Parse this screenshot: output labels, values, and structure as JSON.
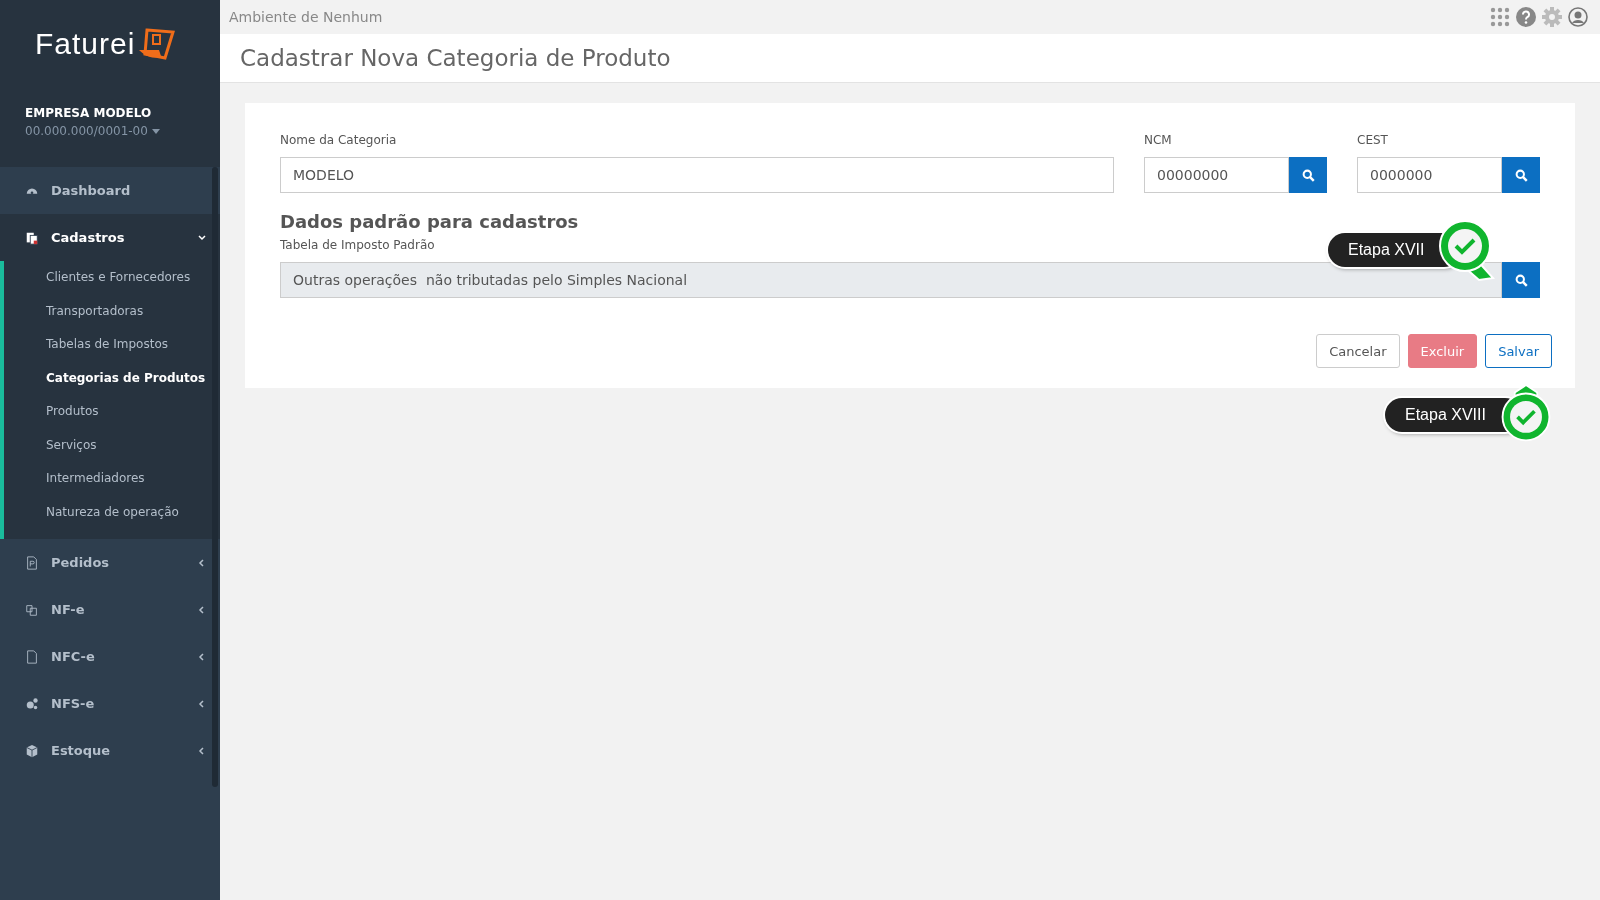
{
  "sidebar": {
    "logo": "Faturei",
    "company": {
      "name": "EMPRESA MODELO",
      "cnpj": "00.000.000/0001-00"
    },
    "items": [
      {
        "label": "Dashboard",
        "kind": "gauge",
        "expanded": false,
        "has_children": false
      },
      {
        "label": "Cadastros",
        "kind": "copy",
        "expanded": true,
        "has_children": true,
        "children": [
          {
            "label": "Clientes e Fornecedores",
            "selected": false
          },
          {
            "label": "Transportadoras",
            "selected": false
          },
          {
            "label": "Tabelas de Impostos",
            "selected": false
          },
          {
            "label": "Categorias de Produtos",
            "selected": true
          },
          {
            "label": "Produtos",
            "selected": false
          },
          {
            "label": "Serviços",
            "selected": false
          },
          {
            "label": "Intermediadores",
            "selected": false
          },
          {
            "label": "Natureza de operação",
            "selected": false
          }
        ]
      },
      {
        "label": "Pedidos",
        "kind": "doc",
        "expanded": false,
        "has_children": true
      },
      {
        "label": "NF-e",
        "kind": "docs",
        "expanded": false,
        "has_children": true
      },
      {
        "label": "NFC-e",
        "kind": "file",
        "expanded": false,
        "has_children": true
      },
      {
        "label": "NFS-e",
        "kind": "gears",
        "expanded": false,
        "has_children": true
      },
      {
        "label": "Estoque",
        "kind": "cube",
        "expanded": false,
        "has_children": true
      }
    ]
  },
  "topbar": {
    "environment": "Ambiente de Nenhum"
  },
  "page": {
    "title": "Cadastrar Nova Categoria de Produto"
  },
  "form": {
    "fields": [
      {
        "label": "Nome da Categoria",
        "value": "MODELO",
        "search": false
      },
      {
        "label": "NCM",
        "value": "00000000",
        "search": true
      },
      {
        "label": "CEST",
        "value": "0000000",
        "search": true
      }
    ],
    "section_title": "Dados padrão para cadastros",
    "tax_table": {
      "label": "Tabela de Imposto Padrão",
      "value": "Outras operações  não tributadas pelo Simples Nacional",
      "disabled": true
    },
    "buttons": [
      {
        "label": "Cancelar",
        "kind": "default"
      },
      {
        "label": "Excluir",
        "kind": "danger"
      },
      {
        "label": "Salvar",
        "kind": "primary"
      }
    ]
  },
  "steps": [
    {
      "label": "Etapa XVII",
      "done": true
    },
    {
      "label": "Etapa XVIII",
      "done": true
    }
  ]
}
